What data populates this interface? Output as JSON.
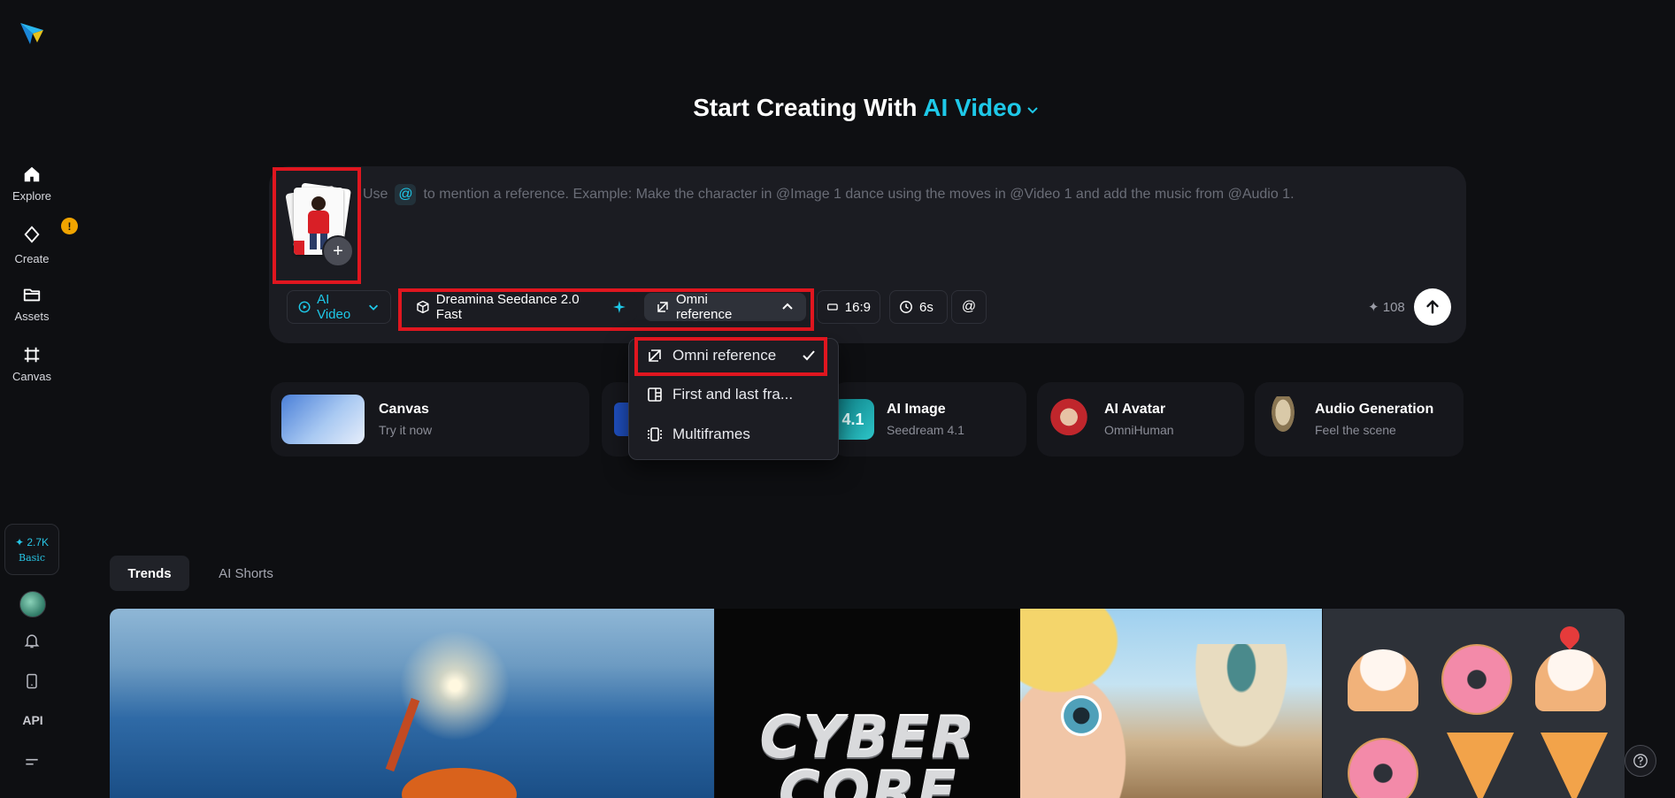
{
  "sidebar": {
    "items": [
      {
        "label": "Explore"
      },
      {
        "label": "Create",
        "badge": "!"
      },
      {
        "label": "Assets"
      },
      {
        "label": "Canvas"
      }
    ],
    "credits": {
      "value": "✦ 2.7K",
      "tier": "Basic"
    },
    "api_label": "API"
  },
  "header": {
    "title_prefix": "Start Creating With",
    "title_accent": "AI Video"
  },
  "prompt": {
    "before": "Use",
    "at": "@",
    "after": "to mention a reference. Example: Make the character in @Image 1 dance using the moves in @Video 1 and add the music from @Audio 1."
  },
  "toolbar": {
    "mode": "AI Video",
    "model": "Dreamina Seedance 2.0 Fast",
    "reference": "Omni reference",
    "ratio": "16:9",
    "duration": "6s",
    "mention": "@",
    "cost": "✦ 108"
  },
  "reference_menu": {
    "options": [
      "Omni reference",
      "First and last fra...",
      "Multiframes"
    ],
    "selected": "Omni reference"
  },
  "features": [
    {
      "title": "Canvas",
      "subtitle": "Try it now"
    },
    {
      "title": "AI Image",
      "subtitle": "Seedream 4.1",
      "icon_text": "4.1"
    },
    {
      "title": "AI Avatar",
      "subtitle": "OmniHuman"
    },
    {
      "title": "Audio Generation",
      "subtitle": "Feel the scene"
    }
  ],
  "tabs": [
    {
      "label": "Trends",
      "active": true
    },
    {
      "label": "AI Shorts",
      "active": false
    }
  ],
  "gallery": {
    "tile2_text": [
      "CYBER",
      "CORE"
    ]
  },
  "colors": {
    "accent": "#1ec8e8",
    "highlight": "#e0161f",
    "background": "#0e0f12",
    "panel": "#1b1c22"
  }
}
